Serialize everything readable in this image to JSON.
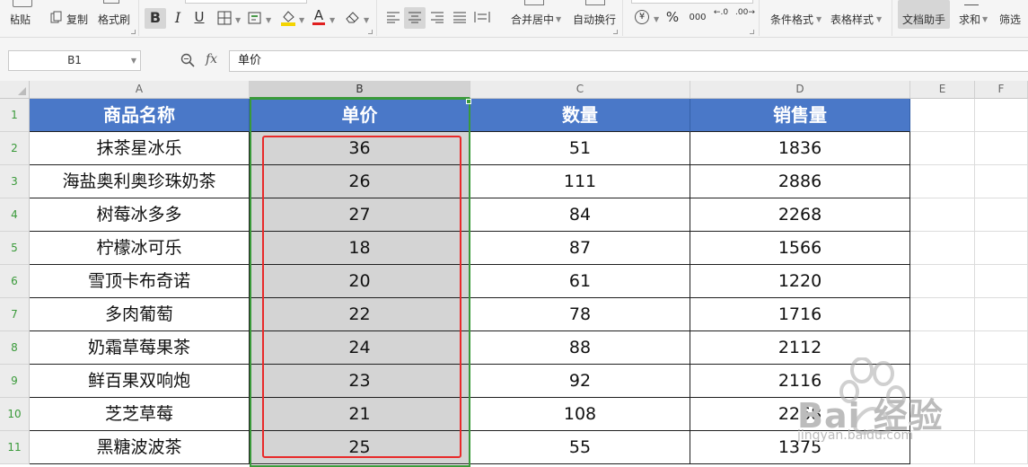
{
  "ribbon": {
    "paste_label": "粘贴",
    "copy_label": "复制",
    "format_painter_label": "格式刷",
    "merge_center_label": "合并居中",
    "wrap_text_label": "自动换行",
    "conditional_format_label": "条件格式",
    "table_style_label": "表格样式",
    "doc_assistant_label": "文档助手",
    "sum_label": "求和",
    "filter_label": "筛选",
    "bold_icon": "B",
    "italic_icon": "I",
    "underline_icon": "U",
    "font_color_icon": "A",
    "percent_icon": "%",
    "currency_icon": "¥",
    "thousands_icon": "000",
    "inc_decimal_icon": "←.0",
    "dec_decimal_icon": ".00→"
  },
  "formula_bar": {
    "cell_reference": "B1",
    "fx_label": "fx",
    "formula_value": "单价"
  },
  "sheet": {
    "columns": [
      "A",
      "B",
      "C",
      "D",
      "E",
      "F"
    ],
    "selected_column": "B",
    "header_row": [
      "商品名称",
      "单价",
      "数量",
      "销售量"
    ],
    "rows": [
      {
        "row": "1"
      },
      {
        "row": "2",
        "cells": [
          "抹茶星冰乐",
          "36",
          "51",
          "1836"
        ]
      },
      {
        "row": "3",
        "cells": [
          "海盐奥利奥珍珠奶茶",
          "26",
          "111",
          "2886"
        ]
      },
      {
        "row": "4",
        "cells": [
          "树莓冰多多",
          "27",
          "84",
          "2268"
        ]
      },
      {
        "row": "5",
        "cells": [
          "柠檬冰可乐",
          "18",
          "87",
          "1566"
        ]
      },
      {
        "row": "6",
        "cells": [
          "雪顶卡布奇诺",
          "20",
          "61",
          "1220"
        ]
      },
      {
        "row": "7",
        "cells": [
          "多肉葡萄",
          "22",
          "78",
          "1716"
        ]
      },
      {
        "row": "8",
        "cells": [
          "奶霜草莓果茶",
          "24",
          "88",
          "2112"
        ]
      },
      {
        "row": "9",
        "cells": [
          "鲜百果双响炮",
          "23",
          "92",
          "2116"
        ]
      },
      {
        "row": "10",
        "cells": [
          "芝芝草莓",
          "21",
          "108",
          "2268"
        ]
      },
      {
        "row": "11",
        "cells": [
          "黑糖波波茶",
          "25",
          "55",
          "1375"
        ]
      }
    ]
  },
  "colors": {
    "header_fill": "#4a78c8",
    "selection_border": "#3a9a3a",
    "annotation_border": "#e82a2a",
    "selected_fill": "#d4d4d4"
  },
  "watermark": {
    "brand": "Bai 经验",
    "url": "jingyan.baidu.com"
  }
}
